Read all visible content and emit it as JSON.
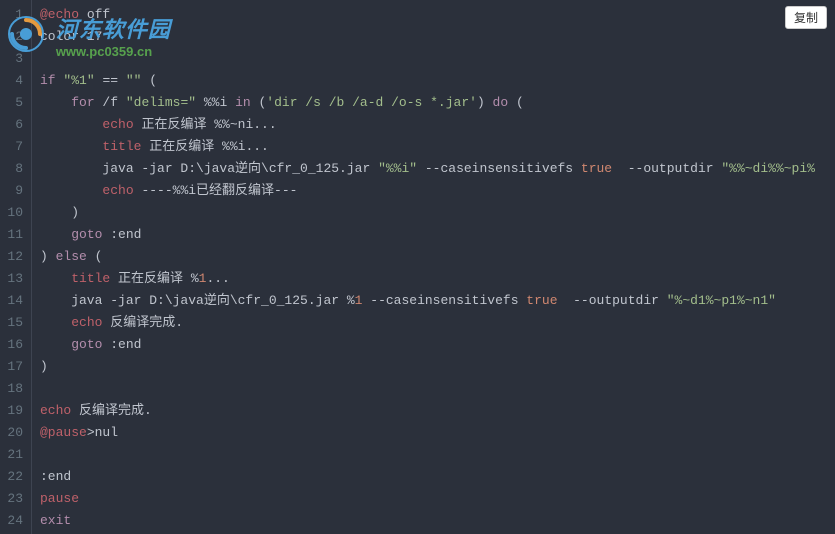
{
  "copy_button": "复制",
  "watermark": {
    "cn_text": "河东软件园",
    "url": "www.pc0359.cn"
  },
  "lines": [
    {
      "n": 1,
      "segs": [
        [
          "pink",
          "@echo"
        ],
        [
          "cmd",
          " off"
        ]
      ]
    },
    {
      "n": 2,
      "segs": [
        [
          "cmd",
          "color 17"
        ]
      ]
    },
    {
      "n": 3,
      "segs": [
        [
          "cmd",
          ""
        ]
      ]
    },
    {
      "n": 4,
      "segs": [
        [
          "kw",
          "if"
        ],
        [
          "cmd",
          " "
        ],
        [
          "str",
          "\"%1\""
        ],
        [
          "cmd",
          " == "
        ],
        [
          "str",
          "\"\""
        ],
        [
          "cmd",
          " ("
        ]
      ]
    },
    {
      "n": 5,
      "segs": [
        [
          "cmd",
          "    "
        ],
        [
          "kw",
          "for"
        ],
        [
          "cmd",
          " /f "
        ],
        [
          "str",
          "\"delims=\""
        ],
        [
          "cmd",
          " %%i "
        ],
        [
          "kw",
          "in"
        ],
        [
          "cmd",
          " ("
        ],
        [
          "str",
          "'dir /s /b /a-d /o-s *.jar'"
        ],
        [
          "cmd",
          ") "
        ],
        [
          "kw",
          "do"
        ],
        [
          "cmd",
          " ("
        ]
      ]
    },
    {
      "n": 6,
      "segs": [
        [
          "cmd",
          "        "
        ],
        [
          "pink",
          "echo"
        ],
        [
          "cmd",
          " 正在反编译 %%~ni..."
        ]
      ]
    },
    {
      "n": 7,
      "segs": [
        [
          "cmd",
          "        "
        ],
        [
          "pink",
          "title"
        ],
        [
          "cmd",
          " 正在反编译 %%i..."
        ]
      ]
    },
    {
      "n": 8,
      "segs": [
        [
          "cmd",
          "        java -jar D:\\java逆向\\cfr_0_125.jar "
        ],
        [
          "str",
          "\"%%i\""
        ],
        [
          "cmd",
          " --caseinsensitivefs "
        ],
        [
          "bool",
          "true"
        ],
        [
          "cmd",
          "  --outputdir "
        ],
        [
          "str",
          "\"%%~di%%~pi%"
        ]
      ]
    },
    {
      "n": 9,
      "segs": [
        [
          "cmd",
          "        "
        ],
        [
          "pink",
          "echo"
        ],
        [
          "cmd",
          " ----%%i已经翻反编译---"
        ]
      ]
    },
    {
      "n": 10,
      "segs": [
        [
          "cmd",
          "    )"
        ]
      ]
    },
    {
      "n": 11,
      "segs": [
        [
          "cmd",
          "    "
        ],
        [
          "kw",
          "goto"
        ],
        [
          "cmd",
          " :end"
        ]
      ]
    },
    {
      "n": 12,
      "segs": [
        [
          "cmd",
          ") "
        ],
        [
          "kw",
          "else"
        ],
        [
          "cmd",
          " ("
        ]
      ]
    },
    {
      "n": 13,
      "segs": [
        [
          "cmd",
          "    "
        ],
        [
          "pink",
          "title"
        ],
        [
          "cmd",
          " 正在反编译 %"
        ],
        [
          "num",
          "1"
        ],
        [
          "cmd",
          "..."
        ]
      ]
    },
    {
      "n": 14,
      "segs": [
        [
          "cmd",
          "    java -jar D:\\java逆向\\cfr_0_125.jar %"
        ],
        [
          "num",
          "1"
        ],
        [
          "cmd",
          " --caseinsensitivefs "
        ],
        [
          "bool",
          "true"
        ],
        [
          "cmd",
          "  --outputdir "
        ],
        [
          "str",
          "\"%~d1%~p1%~n1\""
        ]
      ]
    },
    {
      "n": 15,
      "segs": [
        [
          "cmd",
          "    "
        ],
        [
          "pink",
          "echo"
        ],
        [
          "cmd",
          " 反编译完成."
        ]
      ]
    },
    {
      "n": 16,
      "segs": [
        [
          "cmd",
          "    "
        ],
        [
          "kw",
          "goto"
        ],
        [
          "cmd",
          " :end"
        ]
      ]
    },
    {
      "n": 17,
      "segs": [
        [
          "cmd",
          ")"
        ]
      ]
    },
    {
      "n": 18,
      "segs": [
        [
          "cmd",
          ""
        ]
      ]
    },
    {
      "n": 19,
      "segs": [
        [
          "pink",
          "echo"
        ],
        [
          "cmd",
          " 反编译完成."
        ]
      ]
    },
    {
      "n": 20,
      "segs": [
        [
          "pink",
          "@pause"
        ],
        [
          "cmd",
          ">nul"
        ]
      ]
    },
    {
      "n": 21,
      "segs": [
        [
          "cmd",
          ""
        ]
      ]
    },
    {
      "n": 22,
      "segs": [
        [
          "cmd",
          ":end"
        ]
      ]
    },
    {
      "n": 23,
      "segs": [
        [
          "pink",
          "pause"
        ]
      ]
    },
    {
      "n": 24,
      "segs": [
        [
          "kw",
          "exit"
        ]
      ]
    }
  ]
}
